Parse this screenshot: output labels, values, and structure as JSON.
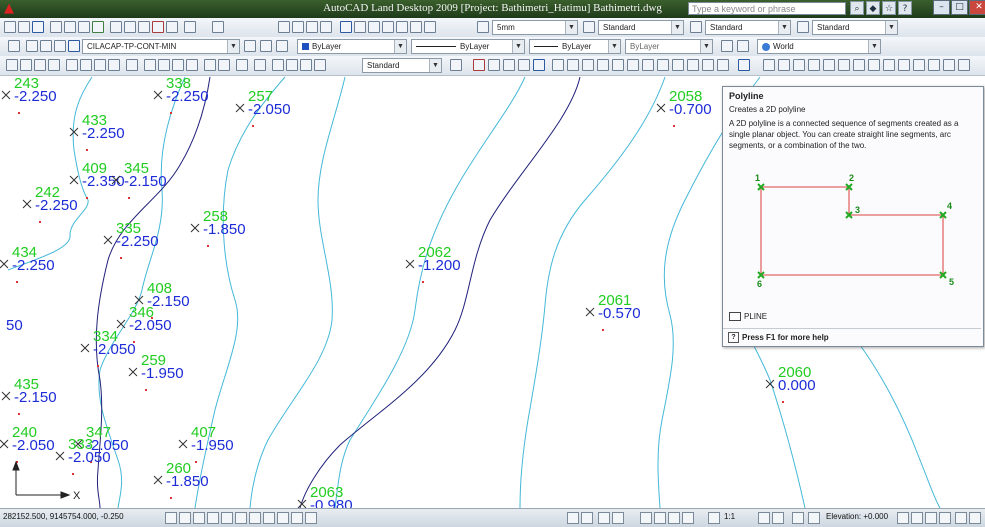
{
  "window": {
    "title": "AutoCAD Land Desktop 2009 [Project: Bathimetri_Hatimu] Bathimetri.dwg",
    "search_placeholder": "Type a keyword or phrase"
  },
  "toolbars": {
    "text_height": "5mm",
    "text_style": "Standard",
    "dim_style": "Standard",
    "table_style": "Standard",
    "current_layer": "CILACAP-TP-CONT-MIN",
    "color": "ByLayer",
    "linetype": "ByLayer",
    "lineweight": "ByLayer",
    "plotstyle": "ByLayer",
    "ucs": "World",
    "visual_style": "Standard"
  },
  "drawing": {
    "contour_color": "#44b8d8",
    "dark_line_color": "#20207a",
    "id_color": "#22cc22",
    "depth_color": "#1c2bd6",
    "points": [
      {
        "id": "243",
        "depth": "-2.250"
      },
      {
        "id": "338",
        "depth": "-2.250"
      },
      {
        "id": "257",
        "depth": "-2.050"
      },
      {
        "id": "433",
        "depth": "-2.250"
      },
      {
        "id": "409",
        "depth": "-2.350"
      },
      {
        "id": "345",
        "depth": "-2.150"
      },
      {
        "id": "242",
        "depth": "-2.250"
      },
      {
        "id": "335",
        "depth": "-2.250"
      },
      {
        "id": "258",
        "depth": "-1.850"
      },
      {
        "id": "434",
        "depth": "-2.250"
      },
      {
        "id": "408",
        "depth": "-2.150"
      },
      {
        "id": "346",
        "depth": "-2.050"
      },
      {
        "id": "334",
        "depth": "-2.050"
      },
      {
        "id": "259",
        "depth": "-1.950"
      },
      {
        "id": "435",
        "depth": "-2.150"
      },
      {
        "id": "407",
        "depth": "-1.950"
      },
      {
        "id": "240",
        "depth": "-2.050"
      },
      {
        "id": "347",
        "depth": "-2.050"
      },
      {
        "id": "333",
        "depth": "-2.050"
      },
      {
        "id": "260",
        "depth": "-1.850"
      },
      {
        "id": "2062",
        "depth": "-1.200"
      },
      {
        "id": "2061",
        "depth": "-0.570"
      },
      {
        "id": "2058",
        "depth": "-0.700"
      },
      {
        "id": "2060",
        "depth": "0.000"
      },
      {
        "id": "2063",
        "depth": "-0.980"
      }
    ],
    "left_edge_label": "50",
    "ucs_x_label": "X"
  },
  "tooltip": {
    "title": "Polyline",
    "subtitle": "Creates a 2D polyline",
    "body": "A 2D polyline is a connected sequence of segments created as a single planar object. You can create straight line segments, arc segments, or a combination of the two.",
    "vertex_labels": [
      "1",
      "2",
      "3",
      "4",
      "5",
      "6"
    ],
    "command": "PLINE",
    "help": "Press F1 for more help"
  },
  "status": {
    "coordinates": "282152.500, 9145754.000, -0.250",
    "annotation_scale": "1:1",
    "elevation": "Elevation: +0.000"
  }
}
